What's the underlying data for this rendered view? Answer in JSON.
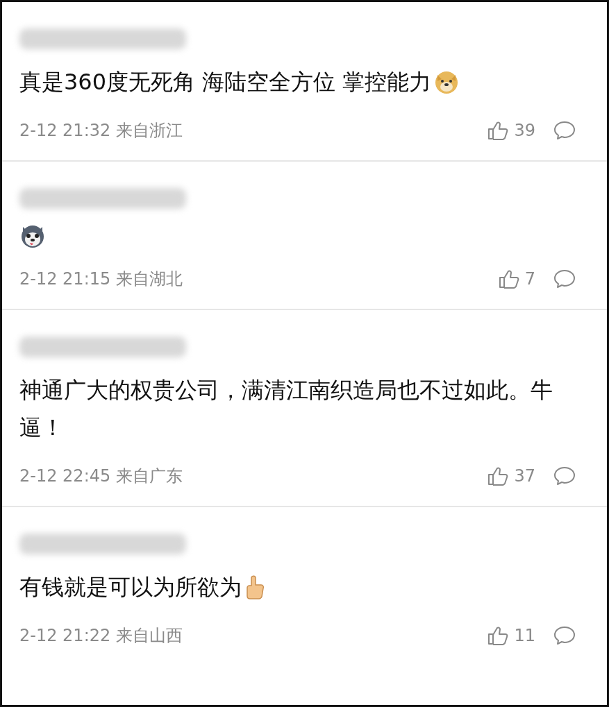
{
  "comments": [
    {
      "username_blurred": true,
      "text": "真是360度无死角 海陆空全方位 掌控能力",
      "kind": "dog",
      "time": "2-12 21:32",
      "location": "来自浙江",
      "likes": "39"
    },
    {
      "username_blurred": true,
      "kind": "husky",
      "time": "2-12 21:15",
      "location": "来自湖北",
      "likes": "7"
    },
    {
      "username_blurred": true,
      "text": "神通广大的权贵公司，满清江南织造局也不过如此。牛逼！",
      "kind": "plain",
      "time": "2-12 22:45",
      "location": "来自广东",
      "likes": "37"
    },
    {
      "username_blurred": true,
      "text": "有钱就是可以为所欲为",
      "kind": "thumb",
      "time": "2-12 21:22",
      "location": "来自山西",
      "likes": "11"
    }
  ]
}
